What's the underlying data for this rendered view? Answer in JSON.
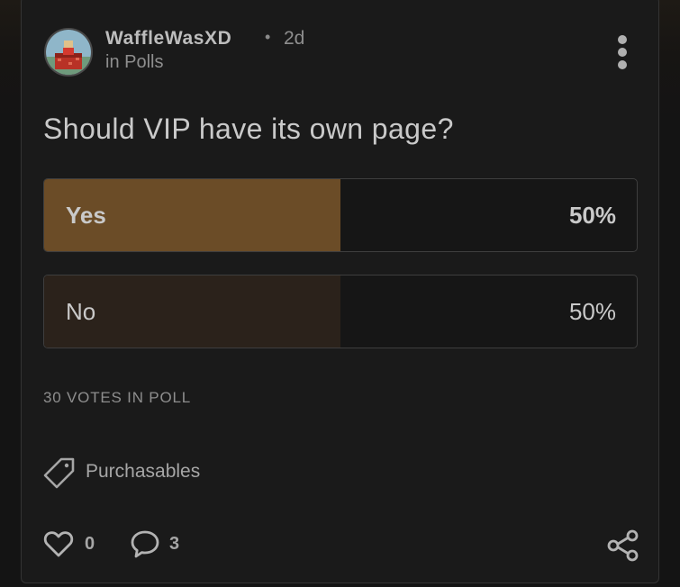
{
  "post": {
    "author": "WaffleWasXD",
    "separator": "•",
    "time_ago": "2d",
    "community": "in Polls",
    "title": "Should VIP have its own page?"
  },
  "poll": {
    "options": [
      {
        "label": "Yes",
        "percent_text": "50%",
        "percent": 50,
        "selected": true
      },
      {
        "label": "No",
        "percent_text": "50%",
        "percent": 50,
        "selected": false
      }
    ],
    "votes_text": "30 VOTES IN POLL"
  },
  "tag": {
    "icon": "tag-icon",
    "label": "Purchasables"
  },
  "actions": {
    "likes": "0",
    "comments": "3",
    "like_icon": "heart-icon",
    "comment_icon": "speech-bubble-icon",
    "share_icon": "share-icon",
    "menu_icon": "vertical-dots-icon"
  },
  "colors": {
    "selected_fill": "#6b4c27",
    "unselected_fill": "#2b221b",
    "card_background": "#1a1a1a",
    "text_primary": "#c9c9c9",
    "text_secondary": "#8e8e8e"
  }
}
